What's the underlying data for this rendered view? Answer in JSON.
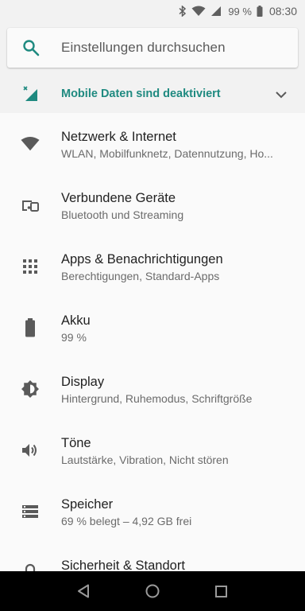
{
  "status_bar": {
    "battery_percent": "99 %",
    "time": "08:30",
    "icons": [
      "bluetooth-icon",
      "wifi-icon",
      "signal-icon",
      "battery-icon"
    ]
  },
  "search": {
    "placeholder": "Einstellungen durchsuchen",
    "icon": "search-icon"
  },
  "condition": {
    "text": "Mobile Daten sind deaktiviert",
    "icon": "mobile-data-off-icon",
    "accent_color": "#1f8a80"
  },
  "settings": {
    "items": [
      {
        "title": "Netzwerk & Internet",
        "subtitle": "WLAN, Mobilfunknetz, Datennutzung, Ho...",
        "icon": "wifi-icon"
      },
      {
        "title": "Verbundene Geräte",
        "subtitle": "Bluetooth und Streaming",
        "icon": "devices-icon"
      },
      {
        "title": "Apps & Benachrichtigungen",
        "subtitle": "Berechtigungen, Standard-Apps",
        "icon": "apps-grid-icon"
      },
      {
        "title": "Akku",
        "subtitle": "99 %",
        "icon": "battery-icon"
      },
      {
        "title": "Display",
        "subtitle": "Hintergrund, Ruhemodus, Schriftgröße",
        "icon": "brightness-icon"
      },
      {
        "title": "Töne",
        "subtitle": "Lautstärke, Vibration, Nicht stören",
        "icon": "volume-icon"
      },
      {
        "title": "Speicher",
        "subtitle": "69 % belegt – 4,92 GB frei",
        "icon": "storage-icon"
      },
      {
        "title": "Sicherheit & Standort",
        "subtitle": "",
        "icon": "lock-icon"
      }
    ]
  },
  "nav": {
    "buttons": [
      "back-icon",
      "home-icon",
      "recents-icon"
    ]
  }
}
